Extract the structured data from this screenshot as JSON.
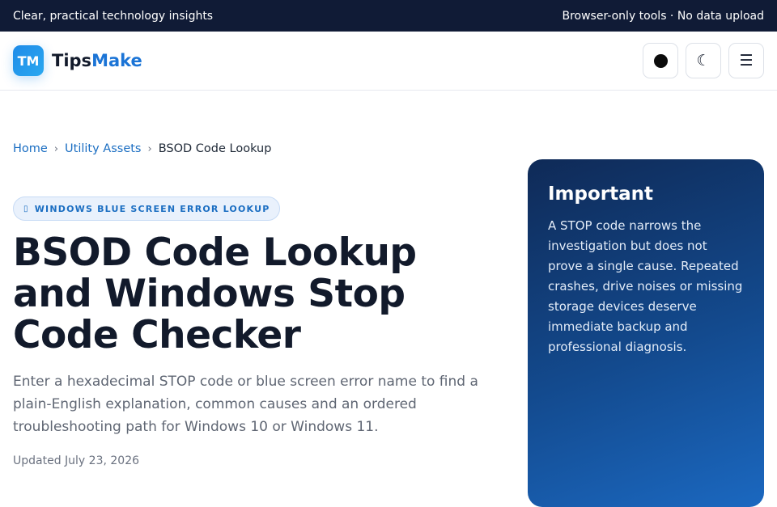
{
  "topbar": {
    "tagline": "Clear, practical technology insights",
    "notice": "Browser-only tools · No data upload"
  },
  "header": {
    "logo_mark": "TM",
    "brand_part1": "Tips",
    "brand_part2": "Make",
    "moon_glyph": "☾",
    "menu_glyph": "☰"
  },
  "breadcrumb": {
    "home": "Home",
    "section": "Utility Assets",
    "current": "BSOD Code Lookup",
    "separator": "›"
  },
  "main": {
    "badge_icon": "▯",
    "badge": "WINDOWS BLUE SCREEN ERROR LOOKUP",
    "title": "BSOD Code Lookup and Windows Stop Code Checker",
    "lead": "Enter a hexadecimal STOP code or blue screen error name to find a plain-English explanation, common causes and an ordered troubleshooting path for Windows 10 or Windows 11.",
    "updated": "Updated July 23, 2026"
  },
  "callout": {
    "title": "Important",
    "body": "A STOP code narrows the investigation but does not prove a single cause. Repeated crashes, drive noises or missing storage devices deserve immediate backup and professional diagnosis."
  },
  "icons": {
    "logo": "tipsmake-logo-icon",
    "accent": "circle-dot-icon",
    "theme": "moon-icon",
    "menu": "hamburger-menu-icon",
    "badge": "monitor-icon"
  },
  "colors": {
    "topbar_bg": "#101b36",
    "brand_accent": "#1b74d6",
    "link": "#1b6ec2",
    "callout_bg": "#134a8e"
  }
}
